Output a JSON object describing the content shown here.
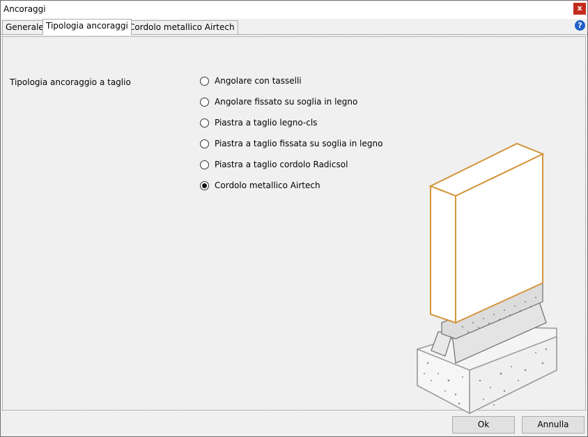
{
  "window": {
    "title": "Ancoraggi",
    "close_glyph": "x"
  },
  "tabs": [
    {
      "label": "Generale"
    },
    {
      "label": "Tipologia ancoraggi"
    },
    {
      "label": "Cordolo metallico Airtech"
    }
  ],
  "help": {
    "glyph": "?"
  },
  "form": {
    "label": "Tipologia ancoraggio a taglio",
    "options": [
      {
        "label": "Angolare con tasselli",
        "checked": false
      },
      {
        "label": "Angolare fissato su soglia in legno",
        "checked": false
      },
      {
        "label": "Piastra a taglio legno-cls",
        "checked": false
      },
      {
        "label": "Piastra a taglio fissata su soglia in legno",
        "checked": false
      },
      {
        "label": "Piastra a taglio cordolo Radicsol",
        "checked": false
      },
      {
        "label": "Cordolo metallico Airtech",
        "checked": true
      }
    ]
  },
  "buttons": {
    "ok": "Ok",
    "cancel": "Annulla"
  },
  "colors": {
    "wall_edge": "#d4943a",
    "close": "#c42b1c",
    "help": "#1e5fc9"
  }
}
